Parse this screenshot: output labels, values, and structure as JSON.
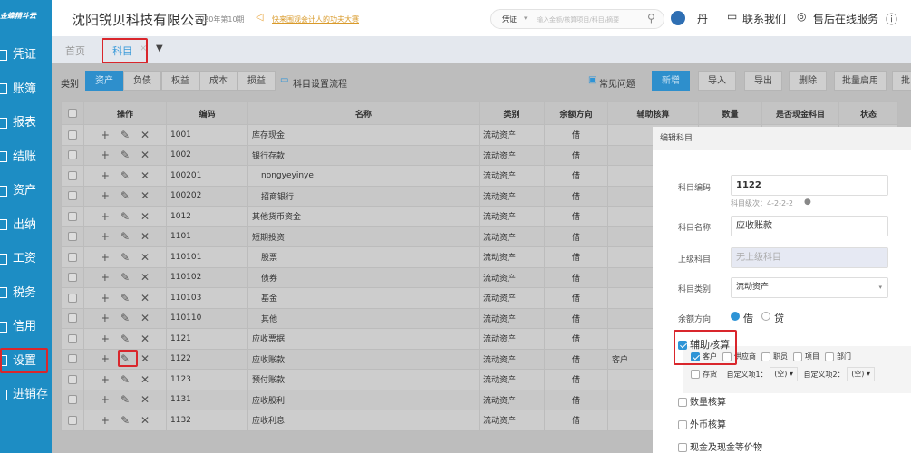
{
  "app": {
    "logo": "金蝶精斗云",
    "company": "沈阳锐贝科技有限公司",
    "period": "2020年第10期",
    "notice": "快来围观会计人的功夫大赛",
    "search_scope": "凭证",
    "search_placeholder": "输入金额/核算项目/科目/摘要",
    "user": "丹",
    "contact": "联系我们",
    "service": "售后在线服务",
    "colors": {
      "sidebar": "#1d8dc4",
      "accent": "#2e94d6",
      "highlight": "#d9262c"
    }
  },
  "sidebar": {
    "items": [
      {
        "label": "凭证"
      },
      {
        "label": "账簿"
      },
      {
        "label": "报表"
      },
      {
        "label": "结账"
      },
      {
        "label": "资产"
      },
      {
        "label": "出纳"
      },
      {
        "label": "工资"
      },
      {
        "label": "税务"
      },
      {
        "label": "信用"
      },
      {
        "label": "设置",
        "active": true
      },
      {
        "label": "进销存"
      }
    ]
  },
  "tabs": [
    {
      "label": "首页"
    },
    {
      "label": "科目",
      "active": true
    }
  ],
  "toolbar": {
    "category_label": "类别",
    "categories": [
      "资产",
      "负债",
      "权益",
      "成本",
      "损益"
    ],
    "flow": "科目设置流程",
    "faq": "常见问题",
    "buttons": [
      "新增",
      "导入",
      "导出",
      "删除",
      "批量启用",
      "批"
    ]
  },
  "table": {
    "headers": [
      "操作",
      "编码",
      "名称",
      "类别",
      "余额方向",
      "辅助核算",
      "数量",
      "是否现金科目",
      "状态"
    ],
    "rows": [
      [
        "1001",
        "库存现金",
        "流动资产",
        "借",
        ""
      ],
      [
        "1002",
        "银行存款",
        "流动资产",
        "借",
        ""
      ],
      [
        "100201",
        "nongyeyinye",
        "流动资产",
        "借",
        ""
      ],
      [
        "100202",
        "招商银行",
        "流动资产",
        "借",
        ""
      ],
      [
        "1012",
        "其他货币资金",
        "流动资产",
        "借",
        ""
      ],
      [
        "1101",
        "短期投资",
        "流动资产",
        "借",
        ""
      ],
      [
        "110101",
        "股票",
        "流动资产",
        "借",
        ""
      ],
      [
        "110102",
        "债券",
        "流动资产",
        "借",
        ""
      ],
      [
        "110103",
        "基金",
        "流动资产",
        "借",
        ""
      ],
      [
        "110110",
        "其他",
        "流动资产",
        "借",
        ""
      ],
      [
        "1121",
        "应收票据",
        "流动资产",
        "借",
        ""
      ],
      [
        "1122",
        "应收账款",
        "流动资产",
        "借",
        "客户"
      ],
      [
        "1123",
        "预付账款",
        "流动资产",
        "借",
        ""
      ],
      [
        "1131",
        "应收股利",
        "流动资产",
        "借",
        ""
      ],
      [
        "1132",
        "应收利息",
        "流动资产",
        "借",
        ""
      ]
    ]
  },
  "modal": {
    "title": "编辑科目",
    "code_label": "科目编码",
    "code": "1122",
    "level_hint": "科目级次：4-2-2-2",
    "name_label": "科目名称",
    "name": "应收账款",
    "parent_label": "上级科目",
    "parent_placeholder": "无上级科目",
    "type_label": "科目类别",
    "type": "流动资产",
    "dir_label": "余额方向",
    "dir_debit": "借",
    "dir_credit": "贷",
    "aux_label": "辅助核算",
    "aux_items": [
      {
        "label": "客户",
        "checked": true
      },
      {
        "label": "供应商",
        "checked": false
      },
      {
        "label": "职员",
        "checked": false
      },
      {
        "label": "项目",
        "checked": false
      },
      {
        "label": "部门",
        "checked": false
      }
    ],
    "stock": "存货",
    "custom1": "自定义项1：",
    "custom2": "自定义项2：",
    "empty": "(空)",
    "qty": "数量核算",
    "fx": "外币核算",
    "cash": "现金及现金等价物"
  }
}
